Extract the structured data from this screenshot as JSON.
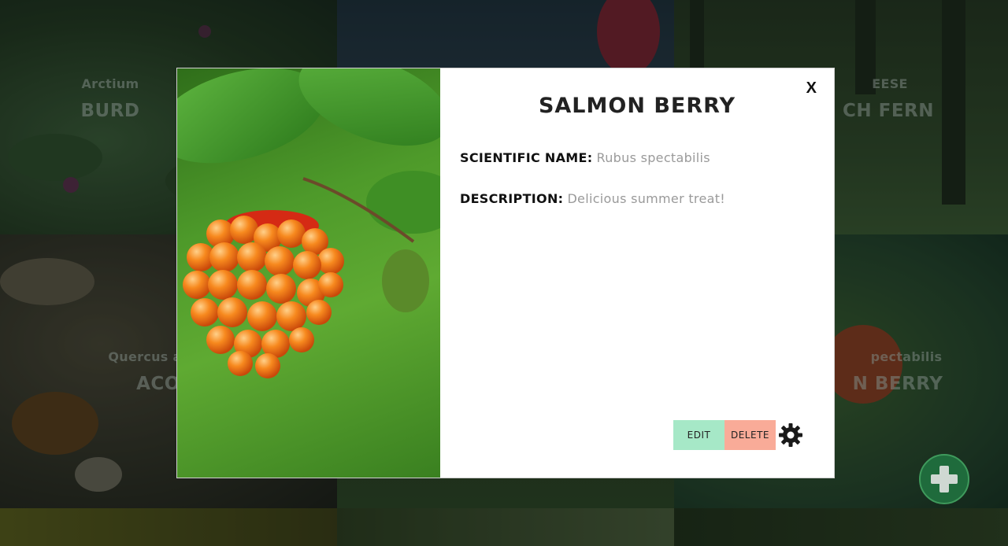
{
  "grid_tiles": [
    {
      "scientific_name": "Arctium",
      "common_name": "BURD"
    },
    {
      "scientific_name": "EESE",
      "common_name": "CH FERN"
    },
    {
      "scientific_name": "Quercus a",
      "common_name": "ACO"
    },
    {
      "scientific_name": "pectabilis",
      "common_name": "N BERRY"
    }
  ],
  "fab": {
    "icon": "plus-icon"
  },
  "modal": {
    "close_label": "X",
    "title": "SALMON BERRY",
    "scientific_name_label": "SCIENTIFIC NAME:",
    "scientific_name_value": "Rubus spectabilis",
    "description_label": "DESCRIPTION:",
    "description_value": "Delicious summer treat!",
    "edit_label": "EDIT",
    "delete_label": "DELETE",
    "settings_icon": "gear-icon"
  },
  "colors": {
    "edit_bg": "#a6e8c7",
    "delete_bg": "#f9ab98",
    "fab_bg": "#1f6b3c"
  }
}
